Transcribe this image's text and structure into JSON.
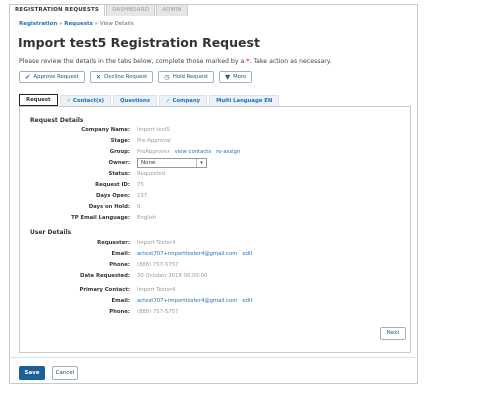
{
  "top_tabs": [
    {
      "label": "REGISTRATION REQUESTS"
    },
    {
      "label": "DASHBOARD"
    },
    {
      "label": "ADMIN"
    }
  ],
  "breadcrumb": {
    "part1": "Registration",
    "sep": " » ",
    "part2": "Requests",
    "part3": "View Details"
  },
  "page_title": "Import test5 Registration Request",
  "intro": {
    "text_before": "Please review the details in the tabs below, complete those marked by a ",
    "star": "*",
    "text_after": ". Take action as necessary."
  },
  "actions": {
    "approve": "Approve Request",
    "decline": "Decline Request",
    "hold": "Hold Request",
    "more": "More"
  },
  "tabs": [
    {
      "label": "Request"
    },
    {
      "label": "Contact(s)",
      "check": "✓"
    },
    {
      "label": "Questions"
    },
    {
      "label": "Company",
      "check": "✓"
    },
    {
      "label": "Multi Language EN"
    }
  ],
  "request_details": {
    "heading": "Request Details",
    "company_name": {
      "label": "Company Name:",
      "value": "Import test5"
    },
    "stage": {
      "label": "Stage:",
      "value": "Pre-Approval"
    },
    "group": {
      "label": "Group:",
      "value": "PreApprover",
      "link1": "view contacts",
      "link2": "re-assign"
    },
    "owner": {
      "label": "Owner:",
      "value": "None"
    },
    "status": {
      "label": "Status:",
      "value": "Requested"
    },
    "request_id": {
      "label": "Request ID:",
      "value": "75"
    },
    "days_open": {
      "label": "Days Open:",
      "value": "237"
    },
    "days_on_hold": {
      "label": "Days on Hold:",
      "value": "0"
    },
    "tp_email_language": {
      "label": "TP Email Language:",
      "value": "English"
    }
  },
  "user_details": {
    "heading": "User Details",
    "requester": {
      "label": "Requester:",
      "value": "Import Tester4"
    },
    "email": {
      "label": "Email:",
      "value": "actest707+importtester4@gmail.com",
      "link": "edit"
    },
    "phone": {
      "label": "Phone:",
      "value": "(888) 757-5757"
    },
    "date_requested": {
      "label": "Date Requested:",
      "value": "30 October 2018 00:00:00"
    },
    "primary_contact": {
      "label": "Primary Contact:",
      "value": "Import Tester4"
    },
    "email2": {
      "label": "Email:",
      "value": "actest707+importtester4@gmail.com",
      "link": "edit"
    },
    "phone2": {
      "label": "Phone:",
      "value": "(888) 757-5757"
    }
  },
  "next_label": "Next",
  "save_label": "Save",
  "cancel_label": "Cancel",
  "colors": {
    "link": "#1f6fb5",
    "primary": "#1f5f98",
    "check": "#49a636",
    "required": "#e03030"
  }
}
